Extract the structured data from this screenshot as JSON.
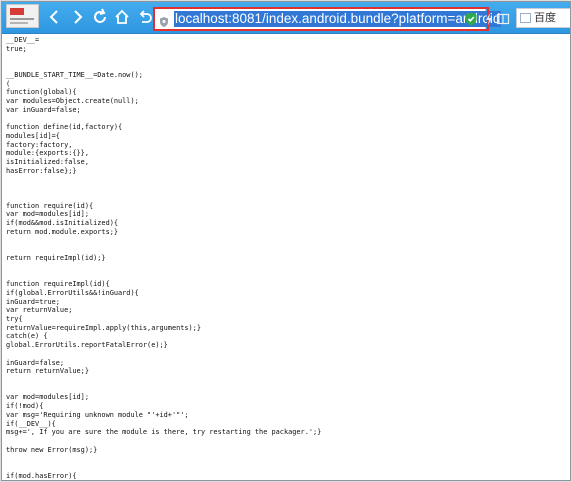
{
  "address_bar": {
    "url": "localhost:8081/index.android.bundle?platform=android"
  },
  "search": {
    "label": "百度"
  },
  "icons": {
    "back": "back-arrow-icon",
    "forward": "forward-arrow-icon",
    "reload": "reload-icon",
    "home": "home-icon",
    "undo": "undo-icon",
    "favorite": "star-icon",
    "site": "site-shield-icon",
    "security": "green-shield-icon",
    "speed": "lightning-icon",
    "compat": "split-view-icon",
    "search_engine": "baidu-icon"
  },
  "colors": {
    "toolbar": "#2f97e0",
    "selection": "#3178d6",
    "highlight_box": "#e03131"
  },
  "source_lines": [
    "__DEV__=",
    "true;",
    "",
    "",
    "__BUNDLE_START_TIME__=Date.now();",
    "(",
    "function(global){",
    "var modules=Object.create(null);",
    "var inGuard=false;",
    "",
    "function define(id,factory){",
    "modules[id]={",
    "factory:factory,",
    "module:{exports:{}},",
    "isInitialized:false,",
    "hasError:false};}",
    "",
    "",
    "",
    "function require(id){",
    "var mod=modules[id];",
    "if(mod&&mod.isInitialized){",
    "return mod.module.exports;}",
    "",
    "",
    "return requireImpl(id);}",
    "",
    "",
    "function requireImpl(id){",
    "if(global.ErrorUtils&&!inGuard){",
    "inGuard=true;",
    "var returnValue;",
    "try{",
    "returnValue=requireImpl.apply(this,arguments);}",
    "catch(e) {",
    "global.ErrorUtils.reportFatalError(e);}",
    "",
    "inGuard=false;",
    "return returnValue;}",
    "",
    "",
    "var mod=modules[id];",
    "if(!mod){",
    "var msg='Requiring unknown module \"'+id+'\"';",
    "if(__DEV__){",
    "msg+=', If you are sure the module is there, try restarting the packager.';}",
    "",
    "throw new Error(msg);}",
    "",
    "",
    "if(mod.hasError){"
  ]
}
